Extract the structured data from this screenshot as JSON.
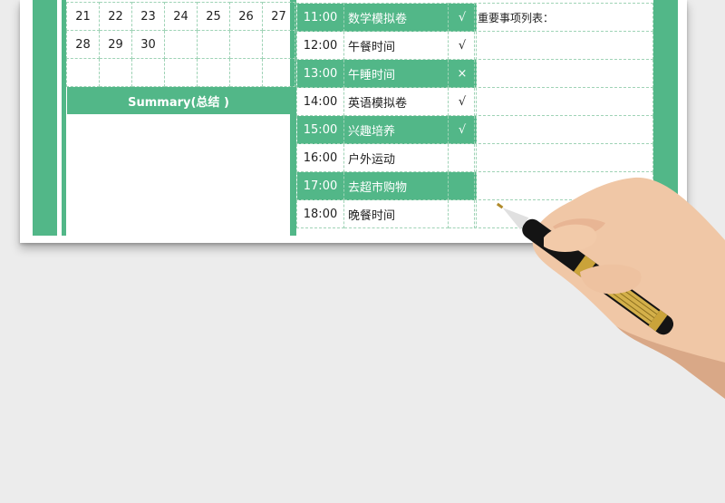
{
  "calendar": {
    "rows": [
      [
        "21",
        "22",
        "23",
        "24",
        "25",
        "26",
        "27"
      ],
      [
        "28",
        "29",
        "30",
        "",
        "",
        "",
        ""
      ],
      [
        "",
        "",
        "",
        "",
        "",
        "",
        ""
      ]
    ]
  },
  "summary": {
    "title": "Summary(总结 )"
  },
  "schedule": [
    {
      "time": "11:00",
      "activity": "数学模拟卷",
      "check": "√",
      "style": "g"
    },
    {
      "time": "12:00",
      "activity": "午餐时间",
      "check": "√",
      "style": "w"
    },
    {
      "time": "13:00",
      "activity": "午睡时间",
      "check": "×",
      "style": "g"
    },
    {
      "time": "14:00",
      "activity": "英语模拟卷",
      "check": "√",
      "style": "w"
    },
    {
      "time": "15:00",
      "activity": "兴趣培养",
      "check": "√",
      "style": "g"
    },
    {
      "time": "16:00",
      "activity": "户外运动",
      "check": "",
      "style": "w"
    },
    {
      "time": "17:00",
      "activity": "去超市购物",
      "check": "",
      "style": "g"
    },
    {
      "time": "18:00",
      "activity": "晚餐时间",
      "check": "",
      "style": "w"
    }
  ],
  "notes": {
    "title": "重要事项列表："
  },
  "colors": {
    "accent": "#52b788",
    "grid": "#9fd3b6"
  }
}
